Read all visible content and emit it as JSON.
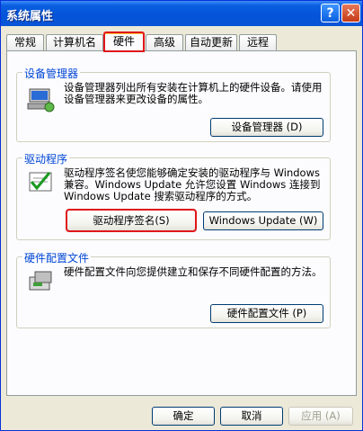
{
  "window": {
    "title": "系统属性",
    "help_glyph": "?",
    "close_glyph": "✕"
  },
  "tabs": [
    {
      "label": "常规"
    },
    {
      "label": "计算机名"
    },
    {
      "label": "硬件"
    },
    {
      "label": "高级"
    },
    {
      "label": "自动更新"
    },
    {
      "label": "远程"
    }
  ],
  "device_manager": {
    "title": "设备管理器",
    "text": "设备管理器列出所有安装在计算机上的硬件设备。请使用设备管理器来更改设备的属性。",
    "button": "设备管理器 (D)"
  },
  "drivers": {
    "title": "驱动程序",
    "text": "驱动程序签名使您能够确定安装的驱动程序与 Windows 兼容。Windows Update 允许您设置 Windows 连接到 Windows Update 搜索驱动程序的方式。",
    "button_signing": "驱动程序签名(S)",
    "button_update": "Windows Update (W)"
  },
  "hw_profiles": {
    "title": "硬件配置文件",
    "text": "硬件配置文件向您提供建立和保存不同硬件配置的方法。",
    "button": "硬件配置文件 (P)"
  },
  "footer": {
    "ok": "确定",
    "cancel": "取消",
    "apply": "应用 (A)"
  }
}
